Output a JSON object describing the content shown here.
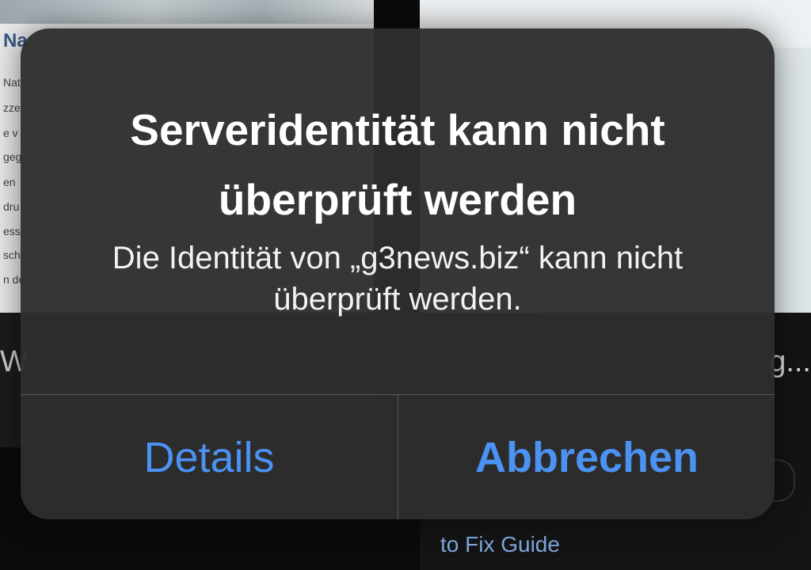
{
  "background": {
    "left_tab": {
      "heading": "Na",
      "snippet_lines": [
        "Nat",
        "zze",
        "e v",
        "geg",
        "en",
        "dru",
        "ess",
        "sch",
        "n de"
      ],
      "title": "W"
    },
    "right_tab": {
      "title": "g...",
      "caption": "to Fix Guide"
    }
  },
  "alert": {
    "title": "Serveridentität kann nicht überprüft werden",
    "message": "Die Identität von „g3news.biz“ kann nicht überprüft werden.",
    "buttons": {
      "details": "Details",
      "cancel": "Abbrechen"
    }
  },
  "colors": {
    "accent": "#4b92f2",
    "alert_background": "#2e2e2e"
  }
}
